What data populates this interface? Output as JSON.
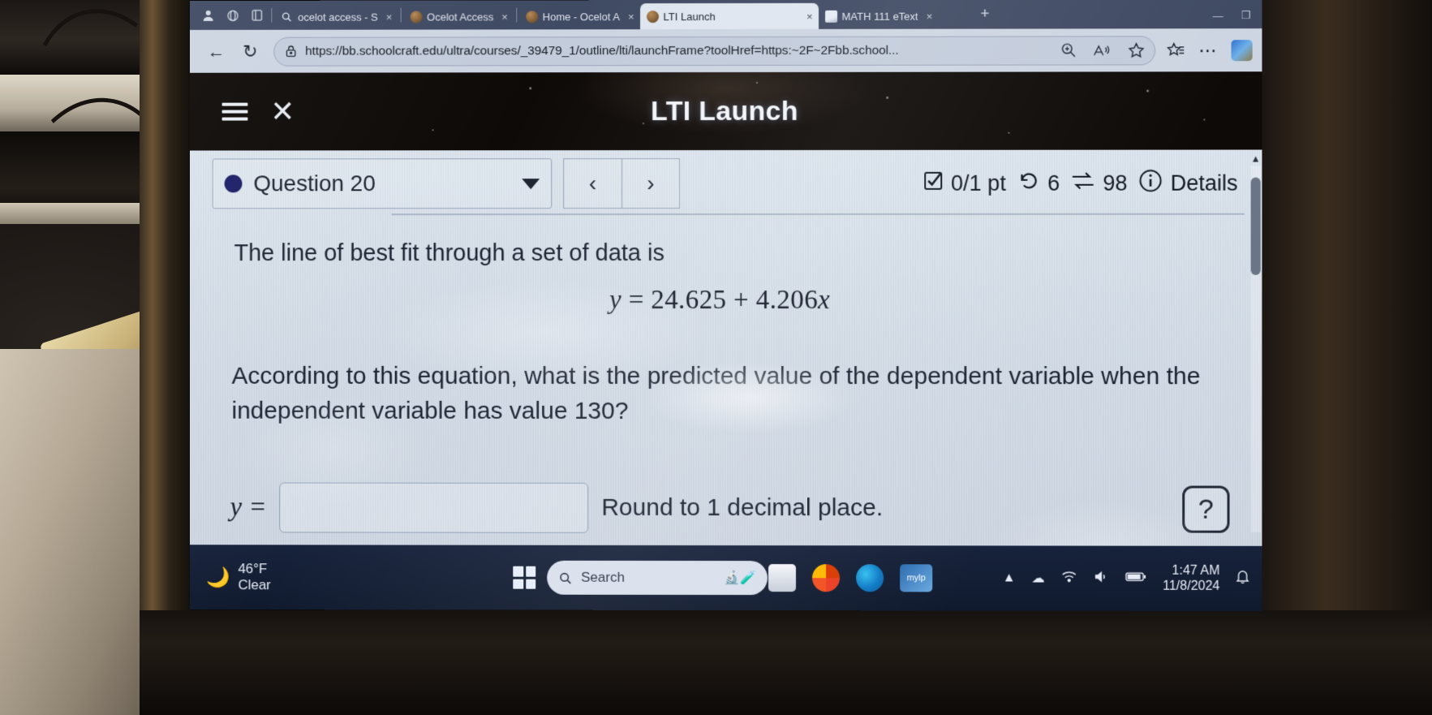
{
  "browser": {
    "tabs": [
      {
        "label": "ocelot access - S",
        "favicon": "search-icon",
        "active": false
      },
      {
        "label": "Ocelot Access",
        "favicon": "ocelot-icon",
        "active": false
      },
      {
        "label": "Home - Ocelot A",
        "favicon": "ocelot-icon",
        "active": false
      },
      {
        "label": "LTI Launch",
        "favicon": "ocelot-icon",
        "active": true
      },
      {
        "label": "MATH 111 eText",
        "favicon": "document-icon",
        "active": false
      }
    ],
    "tab_close_label": "×",
    "new_tab_label": "+",
    "window_minimize": "—",
    "window_maximize": "❐",
    "window_close": "×",
    "back_label": "←",
    "refresh_label": "↻",
    "url": "https://bb.schoolcraft.edu/ultra/courses/_39479_1/outline/lti/launchFrame?toolHref=https:~2F~2Fbb.school...",
    "lock_icon": "lock-icon",
    "zoom_icon": "zoom-in-icon",
    "read_aloud_icon": "read-aloud-icon",
    "favorite_icon": "star-icon",
    "collections_icon": "collections-icon",
    "more_icon": "ellipsis-icon",
    "profile_icon": "profile-avatar"
  },
  "lti": {
    "title": "LTI Launch",
    "menu_icon": "hamburger-menu-icon",
    "close_icon": "close-icon"
  },
  "question": {
    "selector_label": "Question 20",
    "dropdown_icon": "chevron-down-icon",
    "prev_label": "‹",
    "next_label": "›",
    "points": "0/1 pt",
    "points_icon": "checkbox-icon",
    "attempts_icon": "retry-icon",
    "attempts": "6",
    "shuffle_icon": "shuffle-icon",
    "shuffle_count": "98",
    "info_icon": "info-icon",
    "details_label": "Details",
    "prompt_line1": "The line of best fit through a set of data is",
    "formula": {
      "lhs": "y",
      "eq": "=",
      "intercept": "24.625",
      "plus": "+",
      "slope": "4.206",
      "variable": "x",
      "full": "y = 24.625 + 4.206x"
    },
    "prompt_line2": "According to this equation, what is the predicted value of the dependent variable when the independent variable has value 130?",
    "answer_label": "y =",
    "answer_value": "",
    "answer_placeholder": "",
    "rounding_note": "Round to 1 decimal place.",
    "help_icon": "question-mark-icon"
  },
  "taskbar": {
    "temperature": "46°F",
    "condition": "Clear",
    "weather_icon": "moon-icon",
    "start_icon": "windows-start-icon",
    "search_placeholder": "Search",
    "search_icon": "search-icon",
    "search_emoji": "science-emoji",
    "apps": [
      {
        "name": "file-explorer",
        "label": ""
      },
      {
        "name": "office",
        "label": ""
      },
      {
        "name": "microsoft-edge",
        "label": ""
      },
      {
        "name": "mylp",
        "label": "mylp"
      }
    ],
    "tray_chevron": "chevron-up-icon",
    "tray_cloud": "onedrive-icon",
    "tray_wifi": "wifi-icon",
    "tray_volume": "volume-icon",
    "tray_battery": "battery-icon",
    "tray_notification": "bell-icon",
    "time": "1:47 AM",
    "date": "11/8/2024"
  },
  "colors": {
    "tabstrip": "#3f4a63",
    "urlbar": "#cdd5e2",
    "lti_header": "#120d0a",
    "quiz_bg": "#d6dfea",
    "question_dot": "#1c1f66",
    "taskbar": "#13203a"
  }
}
